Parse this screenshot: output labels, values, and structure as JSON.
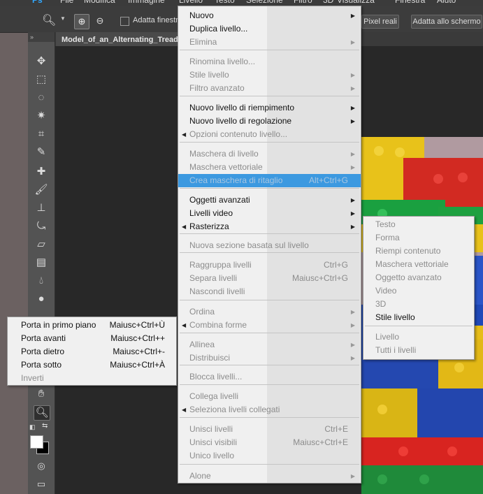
{
  "menubar": {
    "items": [
      "Ps",
      "File",
      "Modifica",
      "Immagine",
      "Livello",
      "Testo",
      "Selezione",
      "Filtro",
      "3D",
      "Visualizza",
      "Finestra",
      "Aiuto"
    ]
  },
  "options_bar": {
    "fit_windows_label": "Adatta finestre",
    "actual_pixels_label": "Pixel reali",
    "fit_screen_label": "Adatta allo schermo"
  },
  "document": {
    "tab_title": "Model_of_an_Alternating_Tread"
  },
  "toolbar": {
    "collapse_label": "»"
  },
  "layer_menu": {
    "items": [
      {
        "label": "Nuovo",
        "shortcut": "",
        "submenu": true,
        "enabled": true
      },
      {
        "label": "Duplica livello...",
        "shortcut": "",
        "submenu": false,
        "enabled": true
      },
      {
        "label": "Elimina",
        "shortcut": "",
        "submenu": true,
        "enabled": false
      },
      {
        "label": "Rinomina livello...",
        "shortcut": "",
        "submenu": false,
        "enabled": false
      },
      {
        "label": "Stile livello",
        "shortcut": "",
        "submenu": true,
        "enabled": false
      },
      {
        "label": "Filtro avanzato",
        "shortcut": "",
        "submenu": true,
        "enabled": false
      },
      {
        "label": "Nuovo livello di riempimento",
        "shortcut": "",
        "submenu": true,
        "enabled": true
      },
      {
        "label": "Nuovo livello di regolazione",
        "shortcut": "",
        "submenu": true,
        "enabled": true
      },
      {
        "label": "Opzioni contenuto livello...",
        "shortcut": "",
        "submenu": false,
        "enabled": false
      },
      {
        "label": "Maschera di livello",
        "shortcut": "",
        "submenu": true,
        "enabled": false
      },
      {
        "label": "Maschera vettoriale",
        "shortcut": "",
        "submenu": true,
        "enabled": false
      },
      {
        "label": "Crea maschera di ritaglio",
        "shortcut": "Alt+Ctrl+G",
        "submenu": false,
        "enabled": false
      },
      {
        "label": "Oggetti avanzati",
        "shortcut": "",
        "submenu": true,
        "enabled": true
      },
      {
        "label": "Livelli video",
        "shortcut": "",
        "submenu": true,
        "enabled": true
      },
      {
        "label": "Rasterizza",
        "shortcut": "",
        "submenu": true,
        "enabled": true
      },
      {
        "label": "Nuova sezione basata sul livello",
        "shortcut": "",
        "submenu": false,
        "enabled": false
      },
      {
        "label": "Raggruppa livelli",
        "shortcut": "Ctrl+G",
        "submenu": false,
        "enabled": false
      },
      {
        "label": "Separa livelli",
        "shortcut": "Maiusc+Ctrl+G",
        "submenu": false,
        "enabled": false
      },
      {
        "label": "Nascondi livelli",
        "shortcut": "",
        "submenu": false,
        "enabled": false
      },
      {
        "label": "Ordina",
        "shortcut": "",
        "submenu": true,
        "enabled": false
      },
      {
        "label": "Combina forme",
        "shortcut": "",
        "submenu": true,
        "enabled": false
      },
      {
        "label": "Allinea",
        "shortcut": "",
        "submenu": true,
        "enabled": false
      },
      {
        "label": "Distribuisci",
        "shortcut": "",
        "submenu": true,
        "enabled": false
      },
      {
        "label": "Blocca livelli...",
        "shortcut": "",
        "submenu": false,
        "enabled": false
      },
      {
        "label": "Collega livelli",
        "shortcut": "",
        "submenu": false,
        "enabled": false
      },
      {
        "label": "Seleziona livelli collegati",
        "shortcut": "",
        "submenu": false,
        "enabled": false
      },
      {
        "label": "Unisci livelli",
        "shortcut": "Ctrl+E",
        "submenu": false,
        "enabled": false
      },
      {
        "label": "Unisci visibili",
        "shortcut": "Maiusc+Ctrl+E",
        "submenu": false,
        "enabled": false
      },
      {
        "label": "Unico livello",
        "shortcut": "",
        "submenu": false,
        "enabled": false
      },
      {
        "label": "Alone",
        "shortcut": "",
        "submenu": true,
        "enabled": false
      }
    ]
  },
  "rasterize_menu": {
    "items": [
      {
        "label": "Testo",
        "enabled": false
      },
      {
        "label": "Forma",
        "enabled": false
      },
      {
        "label": "Riempi contenuto",
        "enabled": false
      },
      {
        "label": "Maschera vettoriale",
        "enabled": false
      },
      {
        "label": "Oggetto avanzato",
        "enabled": false
      },
      {
        "label": "Video",
        "enabled": false
      },
      {
        "label": "3D",
        "enabled": false
      },
      {
        "label": "Stile livello",
        "enabled": true
      },
      {
        "label": "Livello",
        "enabled": false
      },
      {
        "label": "Tutti i livelli",
        "enabled": false
      }
    ]
  },
  "arrange_menu": {
    "items": [
      {
        "label": "Porta in primo piano",
        "shortcut": "Maiusc+Ctrl+Ù",
        "enabled": true
      },
      {
        "label": "Porta avanti",
        "shortcut": "Maiusc+Ctrl++",
        "enabled": true
      },
      {
        "label": "Porta dietro",
        "shortcut": "Maiusc+Ctrl+-",
        "enabled": true
      },
      {
        "label": "Porta sotto",
        "shortcut": "Maiusc+Ctrl+À",
        "enabled": true
      },
      {
        "label": "Inverti",
        "shortcut": "",
        "enabled": false
      }
    ]
  },
  "colors": {
    "highlight": "#3c99e0",
    "menu_bg": "#f0f0f0",
    "workspace": "#282828",
    "toolbar": "#535353"
  }
}
